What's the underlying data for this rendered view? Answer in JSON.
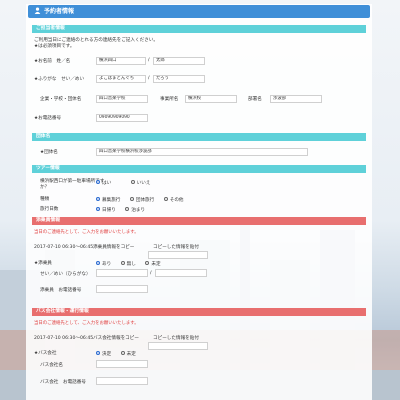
{
  "header": {
    "title": "予約者情報"
  },
  "sections": {
    "booker": "ご担当者情報",
    "group": "団体名",
    "tour": "ツアー情報",
    "guide": "添乗員情報",
    "bus": "バス会社情報・運行情報"
  },
  "booker": {
    "notice_line1": "ご利用当日にご連絡のとれる方の連絡先をご記入ください。",
    "notice_line2": "★は必須項目です。",
    "name_label": "★お名前　姓／名",
    "name_last": "横浜四口",
    "name_first": "太郎",
    "kana_label": "★ふりがな　せい／めい",
    "kana_last": "よこはまどんぐち",
    "kana_first": "たろう",
    "org_label": "企業・学校・団体名",
    "org_value": "四口音楽学校",
    "dept_label": "事業所名",
    "dept_value": "横浜校",
    "div_label": "部署名",
    "div_value": "渉波部",
    "phone_label": "★お電話番号",
    "phone_value": "09090909090"
  },
  "group": {
    "label": "★団体名",
    "value": "四口音楽学校横浜校渉波部"
  },
  "tour": {
    "pickup_label_line1": "横浜駅西口が第一駐車場所です",
    "pickup_label_line2": "か？",
    "pickup_options": [
      "はい",
      "いいえ"
    ],
    "type_label": "種類",
    "type_options": [
      "募集旅行",
      "団体旅行",
      "その他"
    ],
    "trip_label": "旅行日数",
    "trip_options": [
      "日帰り",
      "泊まり"
    ]
  },
  "guide": {
    "notice": "当日のご連絡先として、ご入力をお願いいたします。",
    "history_date": "2017-07-10 06:30〜06:45",
    "copy_info": "添乗員情報をコピー",
    "copy_label": "コピーした情報を貼付",
    "present_label": "★添乗員",
    "present_options": [
      "あり",
      "無し",
      "未定"
    ],
    "kana_label": "せい／めい（ひらがな）",
    "phone_label": "添乗員　お電話番号"
  },
  "bus": {
    "notice": "当日のご連絡先として、ご入力をお願いいたします。",
    "history_date": "2017-07-10 06:30〜06:45",
    "copy_info": "バス会社情報をコピー",
    "copy_label": "コピーした情報を貼付",
    "company_label": "★バス会社",
    "company_options": [
      "決定",
      "未定"
    ],
    "name_label": "バス会社名",
    "phone_label": "バス会社　お電話番号"
  }
}
